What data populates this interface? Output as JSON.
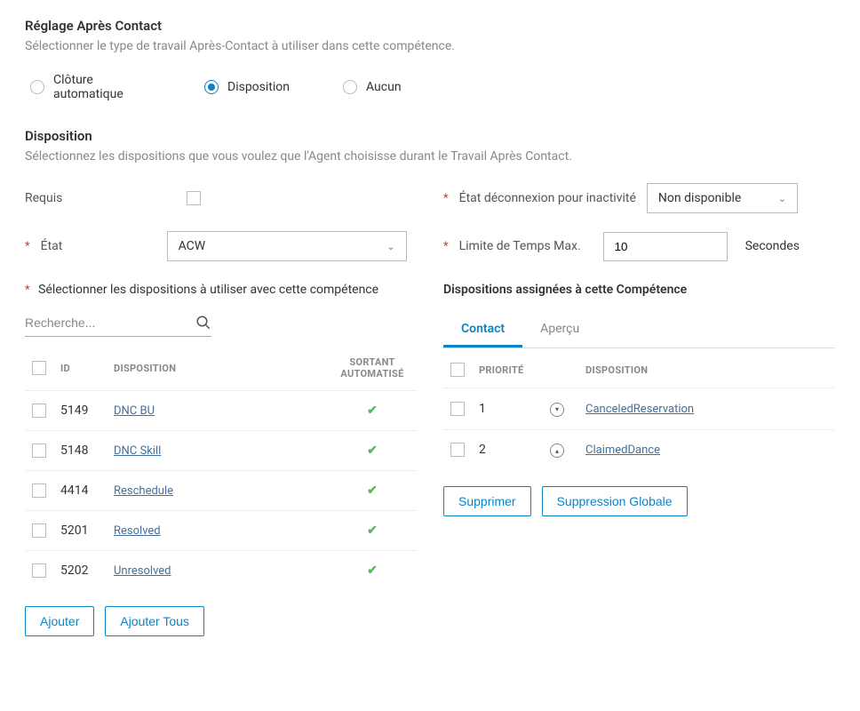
{
  "afterContact": {
    "title": "Réglage Après Contact",
    "desc": "Sélectionner le type de travail Après-Contact à utiliser dans cette compétence.",
    "options": {
      "auto": "Clôture automatique",
      "disposition": "Disposition",
      "none": "Aucun"
    }
  },
  "disposition": {
    "title": "Disposition",
    "desc": "Sélectionnez les dispositions que vous voulez que l'Agent choisisse durant le Travail Après Contact.",
    "required_label": "Requis",
    "state_label": "État",
    "state_value": "ACW",
    "disconnect_label": "État déconnexion pour inactivité",
    "disconnect_value": "Non disponible",
    "timelimit_label": "Limite de Temps Max.",
    "timelimit_value": "10",
    "timelimit_suffix": "Secondes"
  },
  "leftPanel": {
    "title": "Sélectionner les dispositions à utiliser avec cette compétence",
    "search_placeholder": "Recherche...",
    "headers": {
      "id": "ID",
      "disposition": "DISPOSITION",
      "auto": "SORTANT AUTOMATISÉ"
    },
    "rows": [
      {
        "id": "5149",
        "name": "DNC BU"
      },
      {
        "id": "5148",
        "name": "DNC Skill"
      },
      {
        "id": "4414",
        "name": "Reschedule"
      },
      {
        "id": "5201",
        "name": "Resolved"
      },
      {
        "id": "5202",
        "name": "Unresolved"
      }
    ],
    "btn_add": "Ajouter",
    "btn_add_all": "Ajouter Tous"
  },
  "rightPanel": {
    "title": "Dispositions assignées à cette Compétence",
    "tabs": {
      "contact": "Contact",
      "preview": "Aperçu"
    },
    "headers": {
      "priority": "PRIORITÉ",
      "disposition": "DISPOSITION"
    },
    "rows": [
      {
        "priority": "1",
        "name": "CanceledReservation",
        "dir": "down"
      },
      {
        "priority": "2",
        "name": "ClaimedDance",
        "dir": "up"
      }
    ],
    "btn_delete": "Supprimer",
    "btn_delete_all": "Suppression Globale"
  }
}
